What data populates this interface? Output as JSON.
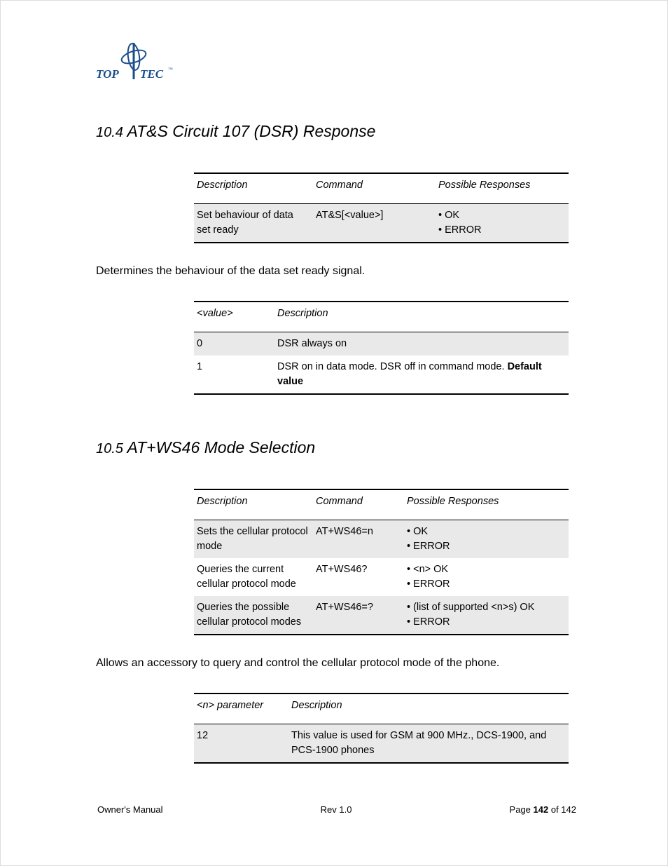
{
  "logo": {
    "top": "TOP",
    "tec": "TEC"
  },
  "section104": {
    "number": "10.4",
    "title": "AT&S Circuit 107 (DSR) Response",
    "cmd_table": {
      "headers": [
        "Description",
        "Command",
        "Possible Responses"
      ],
      "rows": [
        {
          "desc": "Set behaviour of data set ready",
          "cmd": "AT&S[<value>]",
          "resp": [
            "• OK",
            "• ERROR"
          ]
        }
      ]
    },
    "body": "Determines the behaviour of the data set ready signal.",
    "val_table": {
      "headers": [
        "<value>",
        "Description"
      ],
      "rows": [
        {
          "val": "0",
          "desc": "DSR always on",
          "bold": "",
          "shade": true
        },
        {
          "val": "1",
          "desc": "DSR on in data mode. DSR off in command mode. ",
          "bold": "Default value",
          "shade": false
        }
      ]
    }
  },
  "section105": {
    "number": "10.5",
    "title": "AT+WS46  Mode Selection",
    "cmd_table": {
      "headers": [
        "Description",
        "Command",
        "Possible Responses"
      ],
      "rows": [
        {
          "desc": "Sets the cellular protocol mode",
          "cmd": "AT+WS46=n",
          "resp": [
            "• OK",
            "• ERROR"
          ],
          "shade": true
        },
        {
          "desc": "Queries the current cellular protocol mode",
          "cmd": "AT+WS46?",
          "resp": [
            "• <n> OK",
            "• ERROR"
          ],
          "shade": false
        },
        {
          "desc": "Queries the possible cellular protocol modes",
          "cmd": "AT+WS46=?",
          "resp": [
            "• (list of supported <n>s) OK",
            "• ERROR"
          ],
          "shade": true
        }
      ]
    },
    "body": "Allows an accessory to query and control the cellular protocol mode of the phone.",
    "param_table": {
      "headers": [
        "<n> parameter",
        "Description"
      ],
      "rows": [
        {
          "val": "12",
          "desc": "This value is used for GSM at 900 MHz., DCS-1900, and PCS-1900 phones",
          "shade": true
        }
      ]
    }
  },
  "footer": {
    "left": "Owner's Manual",
    "center": "Rev 1.0",
    "right_prefix": "Page ",
    "right_page": "142",
    "right_suffix": " of 142"
  }
}
